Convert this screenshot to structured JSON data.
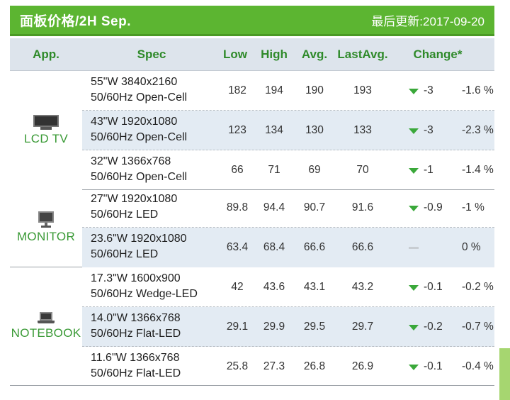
{
  "header": {
    "title": "面板价格/2H Sep.",
    "updated": "最后更新:2017-09-20"
  },
  "columns": {
    "app": "App.",
    "spec": "Spec",
    "low": "Low",
    "high": "High",
    "avg": "Avg.",
    "last_avg": "LastAvg.",
    "change": "Change*"
  },
  "groups": [
    {
      "label": "LCD TV",
      "icon": "tv-icon",
      "rows": [
        {
          "spec_line1": "55\"W 3840x2160",
          "spec_line2": "50/60Hz Open-Cell",
          "low": "182",
          "high": "194",
          "avg": "190",
          "last_avg": "193",
          "trend": "down",
          "change": "-3",
          "change_pct": "-1.6 %"
        },
        {
          "spec_line1": "43\"W 1920x1080",
          "spec_line2": "50/60Hz Open-Cell",
          "low": "123",
          "high": "134",
          "avg": "130",
          "last_avg": "133",
          "trend": "down",
          "change": "-3",
          "change_pct": "-2.3 %"
        },
        {
          "spec_line1": "32\"W 1366x768",
          "spec_line2": "50/60Hz Open-Cell",
          "low": "66",
          "high": "71",
          "avg": "69",
          "last_avg": "70",
          "trend": "down",
          "change": "-1",
          "change_pct": "-1.4 %"
        }
      ]
    },
    {
      "label": "MONITOR",
      "icon": "monitor-icon",
      "rows": [
        {
          "spec_line1": "27\"W 1920x1080",
          "spec_line2": "50/60Hz LED",
          "low": "89.8",
          "high": "94.4",
          "avg": "90.7",
          "last_avg": "91.6",
          "trend": "down",
          "change": "-0.9",
          "change_pct": "-1 %"
        },
        {
          "spec_line1": "23.6\"W 1920x1080",
          "spec_line2": "50/60Hz LED",
          "low": "63.4",
          "high": "68.4",
          "avg": "66.6",
          "last_avg": "66.6",
          "trend": "flat",
          "change": "",
          "change_pct": "0 %"
        }
      ]
    },
    {
      "label": "NOTEBOOK",
      "icon": "notebook-icon",
      "rows": [
        {
          "spec_line1": "17.3\"W 1600x900",
          "spec_line2": "50/60Hz Wedge-LED",
          "low": "42",
          "high": "43.6",
          "avg": "43.1",
          "last_avg": "43.2",
          "trend": "down",
          "change": "-0.1",
          "change_pct": "-0.2 %"
        },
        {
          "spec_line1": "14.0\"W 1366x768",
          "spec_line2": "50/60Hz Flat-LED",
          "low": "29.1",
          "high": "29.9",
          "avg": "29.5",
          "last_avg": "29.7",
          "trend": "down",
          "change": "-0.2",
          "change_pct": "-0.7 %"
        },
        {
          "spec_line1": "11.6\"W 1366x768",
          "spec_line2": "50/60Hz Flat-LED",
          "low": "25.8",
          "high": "27.3",
          "avg": "26.8",
          "last_avg": "26.9",
          "trend": "down",
          "change": "-0.1",
          "change_pct": "-0.4 %"
        }
      ]
    }
  ],
  "colors": {
    "header_bg": "#5cb531",
    "accent_green": "#2f8a2a",
    "row_alt_bg": "#e3ebf3",
    "trend_down": "#3aa83a"
  }
}
